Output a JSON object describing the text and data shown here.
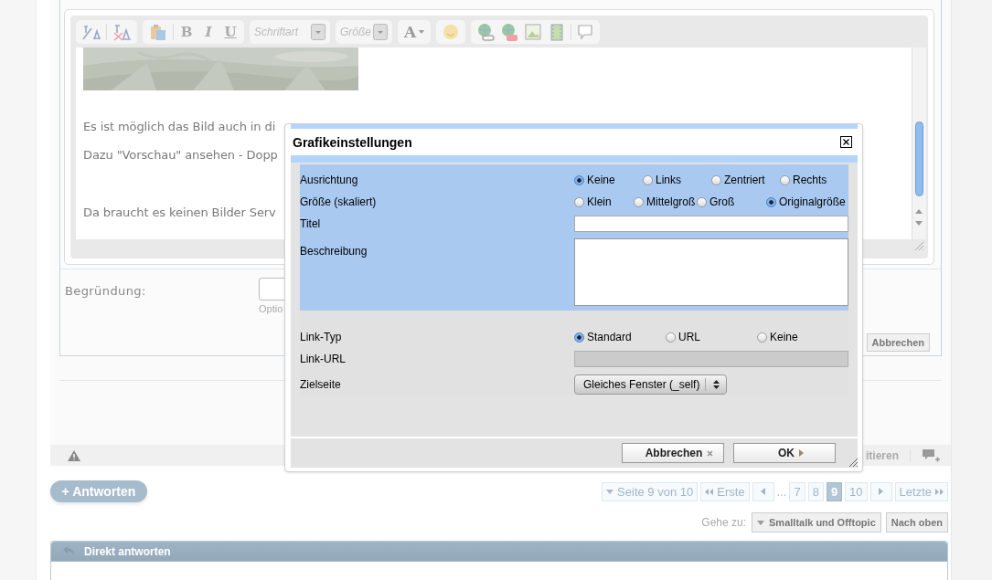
{
  "editor": {
    "toolbar": {
      "bold": "B",
      "italic": "I",
      "underline": "U",
      "font": "Schriftart",
      "size": "Größe",
      "font_color_label": "A"
    },
    "paragraphs": [
      "Es ist möglich das Bild auch in di",
      "Dazu \"Vorschau\" ansehen - Dopp",
      "Da braucht es keinen Bilder Serv"
    ]
  },
  "reason": {
    "label": "Begründung:",
    "hint": "Optio"
  },
  "cancel_button": "Abbrechen",
  "post_footer": {
    "quote": "itieren"
  },
  "reply_button": "+ Antworten",
  "pagination": {
    "summary": "Seite 9 von 10",
    "first": "Erste",
    "ellipsis": "...",
    "last": "Letzte",
    "pages": [
      {
        "label": "7",
        "selected": false
      },
      {
        "label": "8",
        "selected": false
      },
      {
        "label": "9",
        "selected": true
      },
      {
        "label": "10",
        "selected": false
      }
    ]
  },
  "jump": {
    "label": "Gehe zu:",
    "forum": "Smalltalk und Offtopic",
    "top": "Nach oben"
  },
  "quick_reply": {
    "title": "Direkt antworten"
  },
  "dialog": {
    "title": "Grafikeinstellungen",
    "sections": [
      {
        "highlighted": true,
        "rows": [
          {
            "kind": "radios",
            "label": "Ausrichtung",
            "options": [
              {
                "label": "Keine",
                "selected": true
              },
              {
                "label": "Links",
                "selected": false
              },
              {
                "label": "Zentriert",
                "selected": false
              },
              {
                "label": "Rechts",
                "selected": false
              }
            ]
          },
          {
            "kind": "radios",
            "label": "Größe (skaliert)",
            "options": [
              {
                "label": "Klein",
                "selected": false
              },
              {
                "label": "Mittelgroß",
                "selected": false
              },
              {
                "label": "Groß",
                "selected": false
              },
              {
                "label": "Originalgröße",
                "selected": true
              }
            ]
          },
          {
            "kind": "text",
            "label": "Titel",
            "disabled": false
          },
          {
            "kind": "textarea",
            "label": "Beschreibung"
          }
        ]
      },
      {
        "highlighted": false,
        "rows": [
          {
            "kind": "radios",
            "label": "Link-Typ",
            "options": [
              {
                "label": "Standard",
                "selected": true
              },
              {
                "label": "URL",
                "selected": false
              },
              {
                "label": "Keine",
                "selected": false
              }
            ]
          },
          {
            "kind": "text",
            "label": "Link-URL",
            "disabled": true
          },
          {
            "kind": "select",
            "label": "Zielseite",
            "value": "Gleiches Fenster (_self)"
          }
        ]
      }
    ],
    "buttons": [
      {
        "kind": "cancel",
        "label": "Abbrechen"
      },
      {
        "kind": "ok",
        "label": "OK"
      }
    ]
  }
}
